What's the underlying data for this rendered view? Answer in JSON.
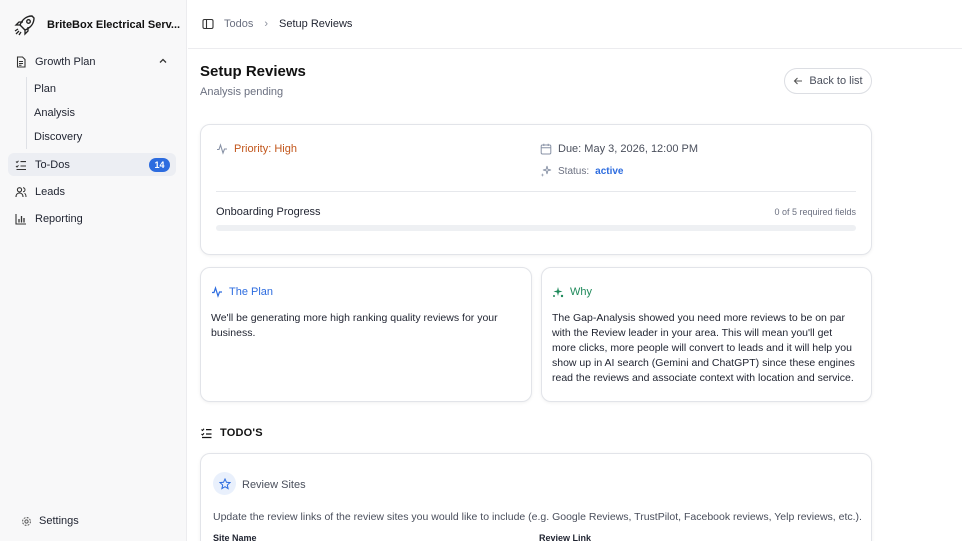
{
  "sidebar": {
    "brand": "BriteBox Electrical Serv...",
    "items": [
      {
        "label": "Growth Plan",
        "icon": "document-icon",
        "expanded": true,
        "children": [
          "Plan",
          "Analysis",
          "Discovery"
        ]
      },
      {
        "label": "To-Dos",
        "icon": "checklist-icon",
        "badge": "14",
        "active": true
      },
      {
        "label": "Leads",
        "icon": "users-icon"
      },
      {
        "label": "Reporting",
        "icon": "bar-chart-icon"
      }
    ],
    "settings": "Settings"
  },
  "breadcrumb": {
    "parent": "Todos",
    "current": "Setup Reviews"
  },
  "page": {
    "title": "Setup Reviews",
    "subtitle": "Analysis pending",
    "back_label": "Back to list"
  },
  "summary": {
    "priority": "Priority: High",
    "due": "Due: May 3, 2026, 12:00 PM",
    "status_label": "Status:",
    "status_value": "active",
    "progress_label": "Onboarding Progress",
    "progress_count": "0 of 5 required fields",
    "progress_fraction": 0
  },
  "plan": {
    "title": "The Plan",
    "body": "We'll be generating more high ranking quality reviews for your business."
  },
  "why": {
    "title": "Why",
    "body": "The Gap-Analysis showed you need more reviews to be on par with the Review leader in your area. This will mean you'll get more clicks, more people will convert to leads and it will help you show up in AI search (Gemini and ChatGPT) since these engines read the reviews and associate context with location and service."
  },
  "todos": {
    "heading": "TODO'S",
    "review_sites": {
      "title": "Review Sites",
      "description": "Update the review links of the review sites you would like to include (e.g. Google Reviews, TrustPilot, Facebook reviews, Yelp reviews, etc.).",
      "col_site": "Site Name",
      "col_link": "Review Link"
    }
  },
  "colors": {
    "accent": "#2d6cdf",
    "priority": "#c2561b",
    "why_icon": "#1f8a5b"
  }
}
